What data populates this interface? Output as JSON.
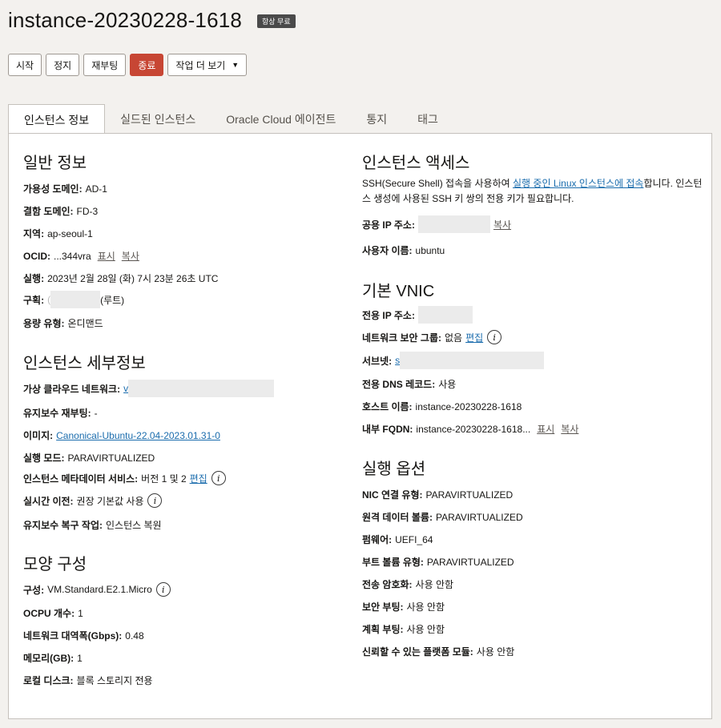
{
  "header": {
    "title": "instance-20230228-1618",
    "badge": "항상 무료"
  },
  "actions": {
    "start": "시작",
    "stop": "정지",
    "reboot": "재부팅",
    "terminate": "종료",
    "more": "작업 더 보기"
  },
  "tabs": [
    {
      "label": "인스턴스 정보"
    },
    {
      "label": "실드된 인스턴스"
    },
    {
      "label": "Oracle Cloud 에이전트"
    },
    {
      "label": "통지"
    },
    {
      "label": "태그"
    }
  ],
  "general": {
    "heading": "일반 정보",
    "ad_label": "가용성 도메인:",
    "ad_value": "AD-1",
    "fd_label": "결함 도메인:",
    "fd_value": "FD-3",
    "region_label": "지역:",
    "region_value": "ap-seoul-1",
    "ocid_label": "OCID:",
    "ocid_value": "...344vra",
    "show": "표시",
    "copy": "복사",
    "launched_label": "실행:",
    "launched_value": "2023년 2월 28일 (화) 7시 23분 26초 UTC",
    "compartment_label": "구획:",
    "compartment_prefix": "(",
    "compartment_suffix": "(루트)",
    "capacity_label": "용량 유형:",
    "capacity_value": "온디맨드"
  },
  "details": {
    "heading": "인스턴스 세부정보",
    "vcn_label": "가상 클라우드 네트워크:",
    "vcn_prefix": "v",
    "maint_reboot_label": "유지보수 재부팅:",
    "maint_reboot_value": "-",
    "image_label": "이미지:",
    "image_value": "Canonical-Ubuntu-22.04-2023.01.31-0",
    "launch_mode_label": "실행 모드:",
    "launch_mode_value": "PARAVIRTUALIZED",
    "metadata_label": "인스턴스 메타데이터 서비스:",
    "metadata_value": "버전 1 및 2",
    "edit": "편집",
    "live_migration_label": "실시간 이전:",
    "live_migration_value": "권장 기본값 사용",
    "maint_recovery_label": "유지보수 복구 작업:",
    "maint_recovery_value": "인스턴스 복원"
  },
  "shape": {
    "heading": "모양 구성",
    "shape_label": "구성:",
    "shape_value": "VM.Standard.E2.1.Micro",
    "ocpu_label": "OCPU 개수:",
    "ocpu_value": "1",
    "bandwidth_label": "네트워크 대역폭(Gbps):",
    "bandwidth_value": "0.48",
    "memory_label": "메모리(GB):",
    "memory_value": "1",
    "disk_label": "로컬 디스크:",
    "disk_value": "블록 스토리지 전용"
  },
  "access": {
    "heading": "인스턴스 액세스",
    "desc_prefix": "SSH(Secure Shell) 접속을 사용하여 ",
    "desc_link": "실행 중인 Linux 인스턴스에 접속",
    "desc_suffix": "합니다. 인스턴스 생성에 사용된 SSH 키 쌍의 전용 키가 필요합니다.",
    "public_ip_label": "공용 IP 주소:",
    "copy": "복사",
    "username_label": "사용자 이름:",
    "username_value": "ubuntu"
  },
  "vnic": {
    "heading": "기본 VNIC",
    "private_ip_label": "전용 IP 주소:",
    "nsg_label": "네트워크 보안 그룹:",
    "nsg_value": "없음",
    "edit": "편집",
    "subnet_label": "서브넷:",
    "subnet_prefix": "s",
    "dns_label": "전용 DNS 레코드:",
    "dns_value": "사용",
    "hostname_label": "호스트 이름:",
    "hostname_value": "instance-20230228-1618",
    "fqdn_label": "내부 FQDN:",
    "fqdn_value": "instance-20230228-1618...",
    "show": "표시",
    "copy": "복사"
  },
  "launch_options": {
    "heading": "실행 옵션",
    "nic_label": "NIC 연결 유형:",
    "nic_value": "PARAVIRTUALIZED",
    "remote_vol_label": "원격 데이터 볼륨:",
    "remote_vol_value": "PARAVIRTUALIZED",
    "firmware_label": "펌웨어:",
    "firmware_value": "UEFI_64",
    "boot_vol_label": "부트 볼륨 유형:",
    "boot_vol_value": "PARAVIRTUALIZED",
    "transit_label": "전송 암호화:",
    "transit_value": "사용 안함",
    "secure_boot_label": "보안 부팅:",
    "secure_boot_value": "사용 안함",
    "measured_boot_label": "계획 부팅:",
    "measured_boot_value": "사용 안함",
    "tpm_label": "신뢰할 수 있는 플랫폼 모듈:",
    "tpm_value": "사용 안함"
  }
}
